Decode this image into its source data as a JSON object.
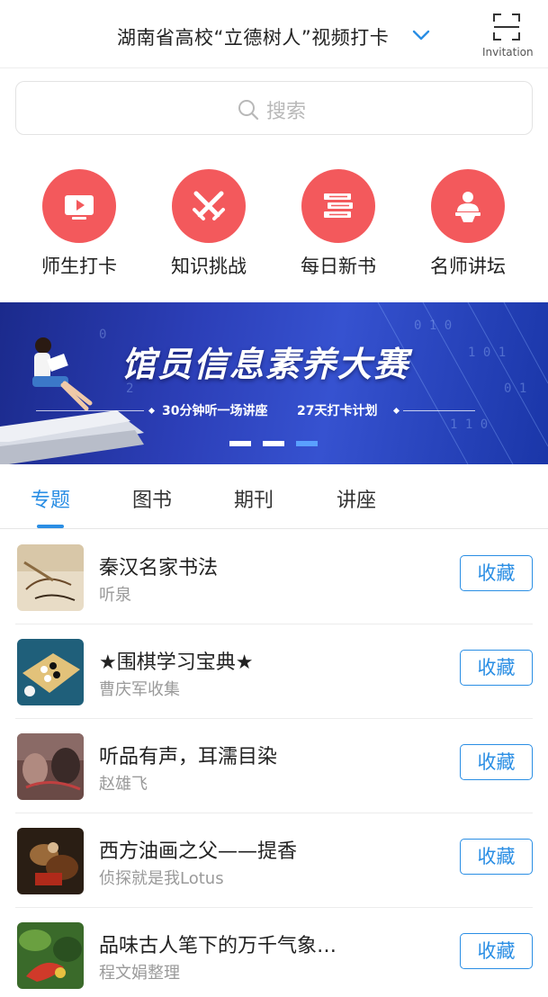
{
  "header": {
    "title": "湖南省高校“立德树人”视频打卡",
    "scan_label": "Invitation"
  },
  "search": {
    "placeholder": "搜索"
  },
  "quick_nav": [
    {
      "label": "师生打卡",
      "icon": "video-play-icon"
    },
    {
      "label": "知识挑战",
      "icon": "crossed-swords-icon"
    },
    {
      "label": "每日新书",
      "icon": "books-stack-icon"
    },
    {
      "label": "名师讲坛",
      "icon": "lecturer-podium-icon"
    }
  ],
  "banner": {
    "title": "馆员信息素养大赛",
    "subtitle_left": "30分钟听一场讲座",
    "subtitle_right": "27天打卡计划",
    "slide_count": 3,
    "active_slide": 3
  },
  "tabs": [
    {
      "label": "专题",
      "active": true
    },
    {
      "label": "图书",
      "active": false
    },
    {
      "label": "期刊",
      "active": false
    },
    {
      "label": "讲座",
      "active": false
    }
  ],
  "list": [
    {
      "title": "秦汉名家书法",
      "subtitle": "听泉",
      "button": "收藏"
    },
    {
      "title": "★围棋学习宝典★",
      "subtitle": "曹庆军收集",
      "button": "收藏"
    },
    {
      "title": "听品有声，耳濡目染",
      "subtitle": "赵雄飞",
      "button": "收藏"
    },
    {
      "title": "西方油画之父——提香",
      "subtitle": "侦探就是我Lotus",
      "button": "收藏"
    },
    {
      "title": "品味古人笔下的万千气象…",
      "subtitle": "程文娟整理",
      "button": "收藏"
    }
  ],
  "colors": {
    "accent_blue": "#2a8ee4",
    "icon_red": "#f3595c"
  }
}
